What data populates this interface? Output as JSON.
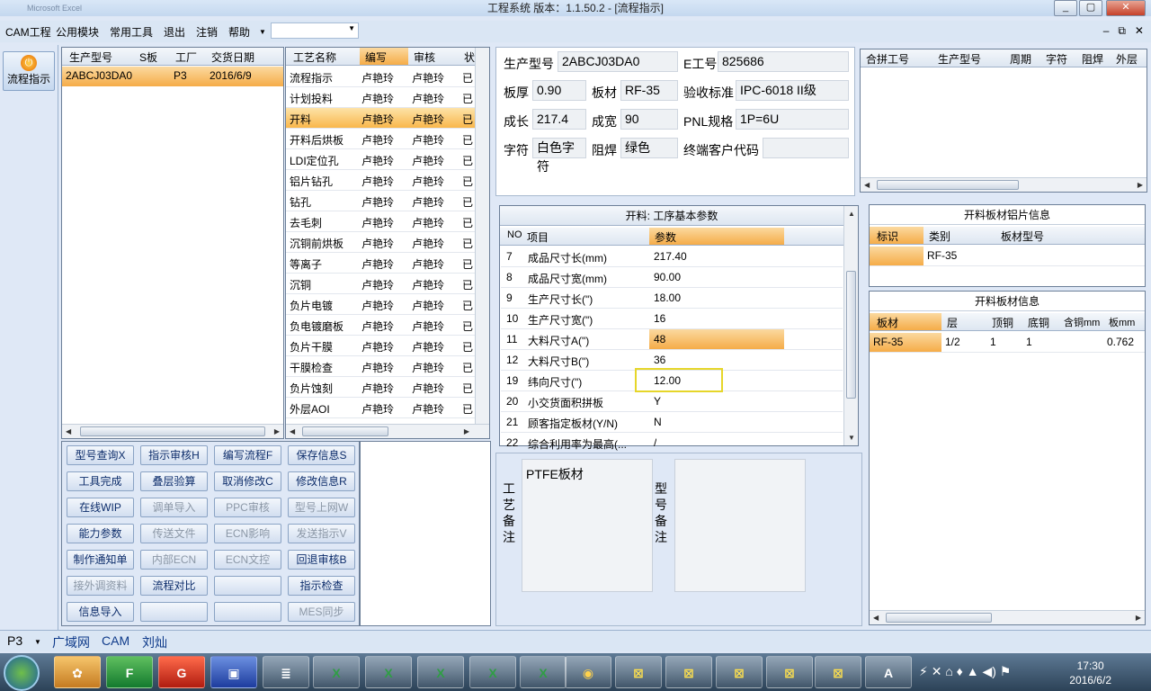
{
  "window": {
    "title": "工程系统  版本：1.1.50.2 - [流程指示]",
    "app_name": "Microsoft Excel"
  },
  "menu": {
    "items": [
      "CAM工程",
      "公用模块",
      "常用工具",
      "退出",
      "注销",
      "帮助"
    ],
    "dropdown_value": ""
  },
  "left": {
    "flow_button": "流程指示"
  },
  "list1": {
    "headers": [
      "生产型号",
      "S板",
      "工厂",
      "交货日期"
    ],
    "row": [
      "2ABCJ03DA0",
      "",
      "P3",
      "2016/6/9"
    ]
  },
  "list2": {
    "headers": [
      "工艺名称",
      "编写",
      "审核",
      "状"
    ],
    "rows": [
      [
        "流程指示",
        "卢艳玲",
        "卢艳玲",
        "已"
      ],
      [
        "计划投料",
        "卢艳玲",
        "卢艳玲",
        "已"
      ],
      [
        "开料",
        "卢艳玲",
        "卢艳玲",
        "已"
      ],
      [
        "开料后烘板",
        "卢艳玲",
        "卢艳玲",
        "已"
      ],
      [
        "LDI定位孔",
        "卢艳玲",
        "卢艳玲",
        "已"
      ],
      [
        "铝片钻孔",
        "卢艳玲",
        "卢艳玲",
        "已"
      ],
      [
        "钻孔",
        "卢艳玲",
        "卢艳玲",
        "已"
      ],
      [
        "去毛刺",
        "卢艳玲",
        "卢艳玲",
        "已"
      ],
      [
        "沉铜前烘板",
        "卢艳玲",
        "卢艳玲",
        "已"
      ],
      [
        "等离子",
        "卢艳玲",
        "卢艳玲",
        "已"
      ],
      [
        "沉铜",
        "卢艳玲",
        "卢艳玲",
        "已"
      ],
      [
        "负片电镀",
        "卢艳玲",
        "卢艳玲",
        "已"
      ],
      [
        "负电镀磨板",
        "卢艳玲",
        "卢艳玲",
        "已"
      ],
      [
        "负片干膜",
        "卢艳玲",
        "卢艳玲",
        "已"
      ],
      [
        "干膜检查",
        "卢艳玲",
        "卢艳玲",
        "已"
      ],
      [
        "负片蚀刻",
        "卢艳玲",
        "卢艳玲",
        "已"
      ],
      [
        "外层AOI",
        "卢艳玲",
        "卢艳玲",
        "已"
      ]
    ]
  },
  "buttons": [
    [
      "型号查询X",
      "指示审核H",
      "编写流程F",
      "保存信息S"
    ],
    [
      "工具完成",
      "叠层验算",
      "取消修改C",
      "修改信息R"
    ],
    [
      "在线WIP",
      "调单导入",
      "PPC审核",
      "型号上网W"
    ],
    [
      "能力参数",
      "传送文件",
      "ECN影响",
      "发送指示V"
    ],
    [
      "制作通知单",
      "内部ECN",
      "ECN文控",
      "回退审核B"
    ],
    [
      "接外调资料",
      "流程对比",
      "",
      "指示检查"
    ],
    [
      "信息导入",
      "",
      "",
      "MES同步"
    ]
  ],
  "info": {
    "prod_model_label": "生产型号",
    "prod_model": "2ABCJ03DA0",
    "e_no_label": "E工号",
    "e_no": "825686",
    "thickness_label": "板厚",
    "thickness": "0.90",
    "material_label": "板材",
    "material": "RF-35",
    "standard_label": "验收标准",
    "standard": "IPC-6018 II级",
    "length_label": "成长",
    "length": "217.4",
    "width_label": "成宽",
    "width": "90",
    "pnl_label": "PNL规格",
    "pnl": "1P=6U",
    "char_label": "字符",
    "char": "白色字符",
    "mask_label": "阻焊",
    "mask": "绿色",
    "customer_label": "终端客户代码",
    "customer": ""
  },
  "rgrid1": {
    "headers": [
      "合拼工号",
      "生产型号",
      "周期",
      "字符",
      "阻焊",
      "外层"
    ]
  },
  "params": {
    "caption": "开料: 工序基本参数",
    "headers": [
      "NO",
      "项目",
      "参数"
    ],
    "rows": [
      [
        "7",
        "成品尺寸长(mm)",
        "217.40"
      ],
      [
        "8",
        "成品尺寸宽(mm)",
        "90.00"
      ],
      [
        "9",
        "生产尺寸长(\")",
        "18.00"
      ],
      [
        "10",
        "生产尺寸宽(\")",
        "16"
      ],
      [
        "11",
        "大料尺寸A(\")",
        "48"
      ],
      [
        "12",
        "大料尺寸B(\")",
        "36"
      ],
      [
        "19",
        "纬向尺寸(\")",
        "12.00"
      ],
      [
        "20",
        "小交货面积拼板",
        "Y"
      ],
      [
        "21",
        "顾客指定板材(Y/N)",
        "N"
      ],
      [
        "22",
        "综合利用率为最高(...",
        "/"
      ]
    ]
  },
  "notes": {
    "proc_label": "工艺备注",
    "proc_text": "PTFE板材",
    "model_label": "型号备注",
    "model_text": ""
  },
  "alu": {
    "caption": "开料板材铝片信息",
    "headers": [
      "标识",
      "类别",
      "板材型号"
    ],
    "row": [
      "",
      "RF-35",
      ""
    ]
  },
  "board": {
    "caption": "开料板材信息",
    "headers": [
      "板材",
      "层",
      "顶铜",
      "底铜",
      "含铜mm",
      "板mm"
    ],
    "row": [
      "RF-35",
      "1/2",
      "1",
      "1",
      "",
      "0.762"
    ]
  },
  "status": {
    "factory": "P3",
    "net": "广域网",
    "dept": "CAM",
    "user": "刘灿"
  },
  "clock": {
    "time": "17:30",
    "date": "2016/6/2"
  },
  "colors": {
    "accent": "#f5ac48",
    "highlight_box": "#e6d62a"
  }
}
